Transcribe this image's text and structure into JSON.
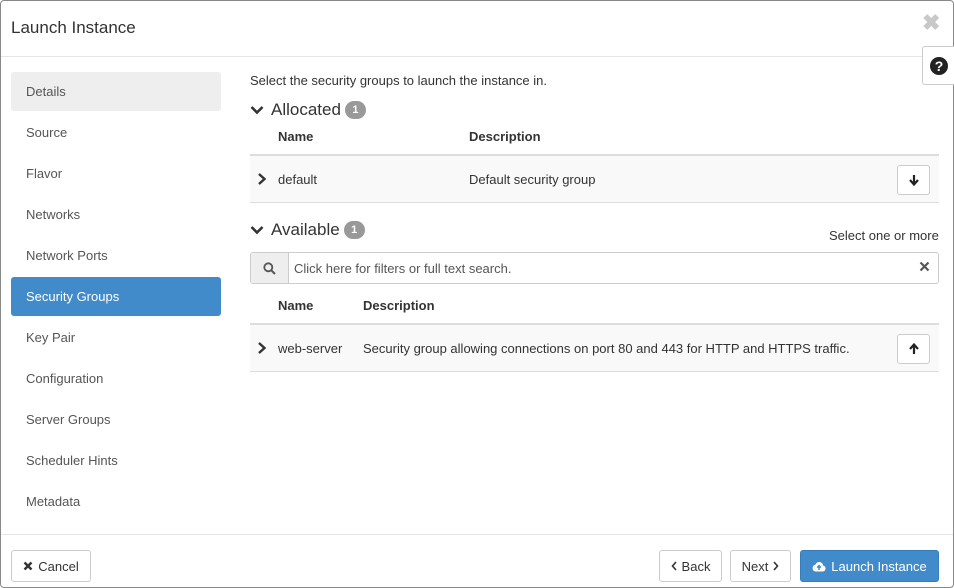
{
  "dialog": {
    "title": "Launch Instance",
    "close_glyph": "✖",
    "help_glyph": "?"
  },
  "nav": {
    "items": [
      {
        "label": "Details"
      },
      {
        "label": "Source"
      },
      {
        "label": "Flavor"
      },
      {
        "label": "Networks"
      },
      {
        "label": "Network Ports"
      },
      {
        "label": "Security Groups"
      },
      {
        "label": "Key Pair"
      },
      {
        "label": "Configuration"
      },
      {
        "label": "Server Groups"
      },
      {
        "label": "Scheduler Hints"
      },
      {
        "label": "Metadata"
      }
    ],
    "active": "Security Groups"
  },
  "content": {
    "intro": "Select the security groups to launch the instance in.",
    "allocated": {
      "title": "Allocated",
      "count": "1",
      "columns": {
        "name": "Name",
        "description": "Description"
      },
      "rows": [
        {
          "name": "default",
          "description": "Default security group"
        }
      ]
    },
    "available": {
      "title": "Available",
      "count": "1",
      "hint": "Select one or more",
      "search_placeholder": "Click here for filters or full text search.",
      "columns": {
        "name": "Name",
        "description": "Description"
      },
      "rows": [
        {
          "name": "web-server",
          "description": "Security group allowing connections on port 80 and 443 for HTTP and HTTPS traffic."
        }
      ]
    }
  },
  "footer": {
    "cancel": "Cancel",
    "back": "Back",
    "next": "Next",
    "launch": "Launch Instance"
  },
  "colors": {
    "accent": "#428bca",
    "badge": "#999999",
    "nav_highlight": "#eeeeee"
  }
}
